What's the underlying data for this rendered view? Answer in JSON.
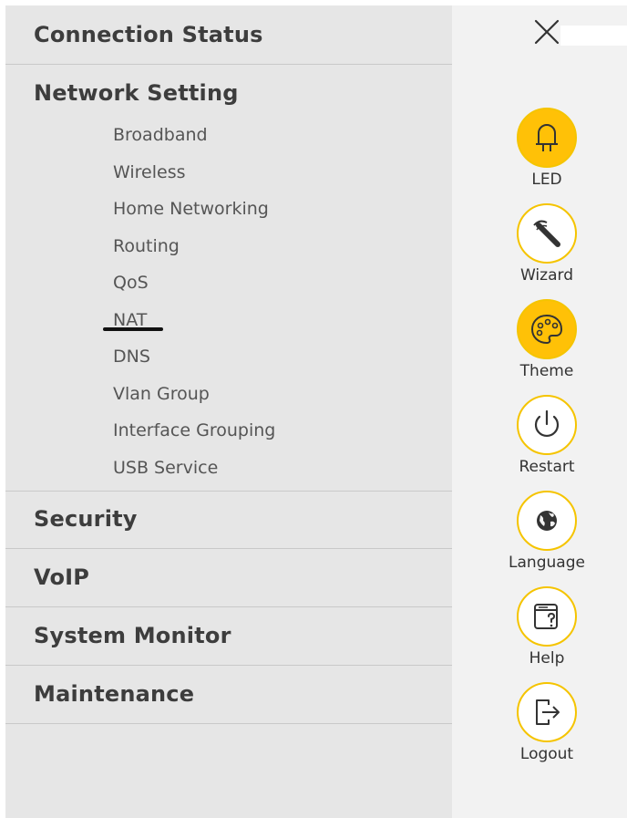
{
  "menu": {
    "sections": [
      {
        "title": "Connection Status"
      },
      {
        "title": "Network Setting",
        "items": [
          "Broadband",
          "Wireless",
          "Home Networking",
          "Routing",
          "QoS",
          "NAT",
          "DNS",
          "Vlan Group",
          "Interface Grouping",
          "USB Service"
        ]
      },
      {
        "title": "Security"
      },
      {
        "title": "VoIP"
      },
      {
        "title": "System Monitor"
      },
      {
        "title": "Maintenance"
      }
    ]
  },
  "toolbar": {
    "close_icon": "close-icon",
    "tools": [
      {
        "label": "LED",
        "icon": "led-icon",
        "active": true
      },
      {
        "label": "Wizard",
        "icon": "wizard-wand-icon",
        "active": false
      },
      {
        "label": "Theme",
        "icon": "palette-icon",
        "active": true
      },
      {
        "label": "Restart",
        "icon": "power-icon",
        "active": false
      },
      {
        "label": "Language",
        "icon": "globe-icon",
        "active": false
      },
      {
        "label": "Help",
        "icon": "help-window-icon",
        "active": false
      },
      {
        "label": "Logout",
        "icon": "logout-icon",
        "active": false
      }
    ]
  },
  "colors": {
    "accent": "#ffc107",
    "accent_border": "#f5c400",
    "menu_bg": "#e6e6e6",
    "side_bg": "#f2f2f2"
  }
}
